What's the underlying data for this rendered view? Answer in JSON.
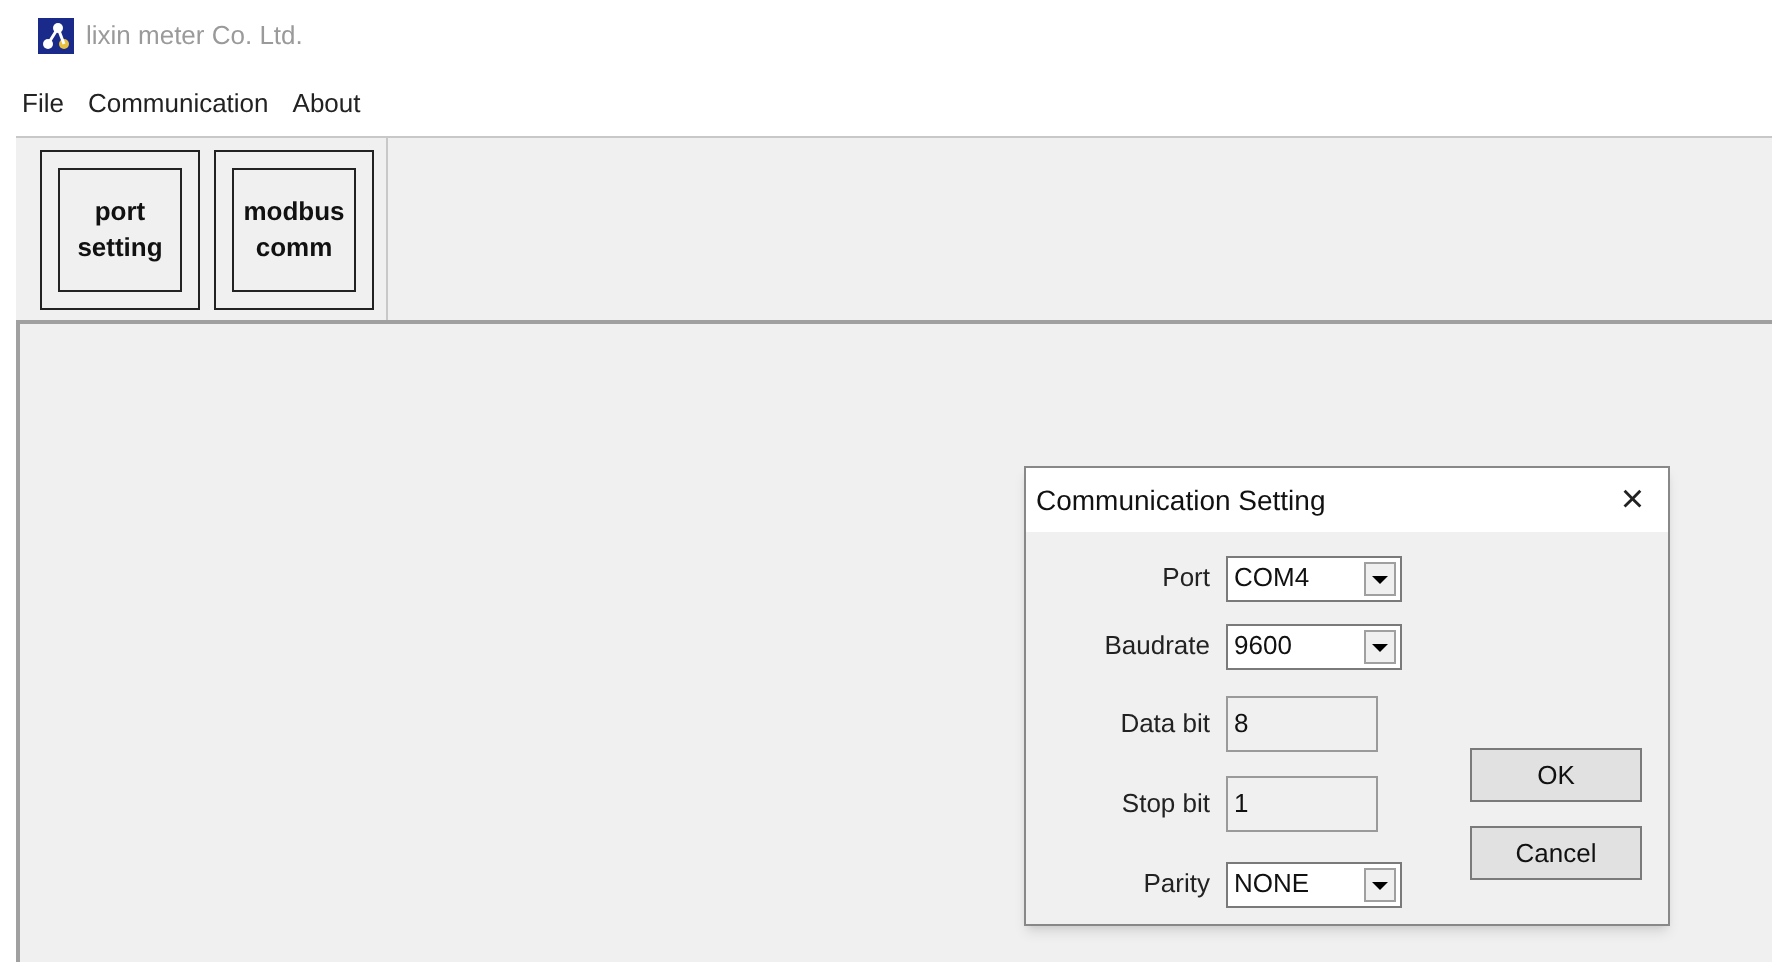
{
  "window": {
    "title": "lixin meter Co. Ltd."
  },
  "menu": [
    "File",
    "Communication",
    "About"
  ],
  "toolbar": [
    {
      "lines": [
        "port",
        "setting"
      ]
    },
    {
      "lines": [
        "modbus",
        "comm"
      ]
    }
  ],
  "dialog": {
    "title": "Communication Setting",
    "close": "×",
    "fields": [
      {
        "label": "Port",
        "kind": "dropdown",
        "value": "COM4",
        "disabled": false
      },
      {
        "label": "Baudrate",
        "kind": "dropdown",
        "value": "9600",
        "disabled": false
      },
      {
        "label": "Data bit",
        "kind": "text",
        "value": "8",
        "disabled": true
      },
      {
        "label": "Stop bit",
        "kind": "text",
        "value": "1",
        "disabled": true
      },
      {
        "label": "Parity",
        "kind": "dropdown",
        "value": "NONE",
        "disabled": false
      }
    ],
    "buttons": [
      "OK",
      "Cancel"
    ]
  }
}
